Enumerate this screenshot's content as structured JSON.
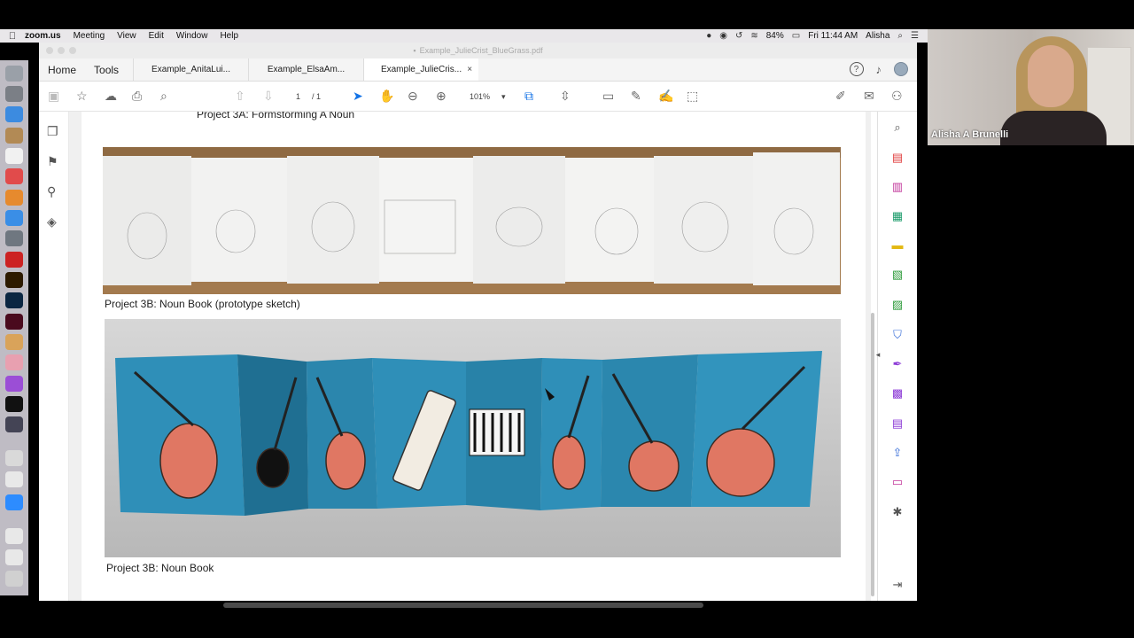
{
  "menubar": {
    "app": "zoom.us",
    "items": [
      "Meeting",
      "View",
      "Edit",
      "Window",
      "Help"
    ],
    "battery": "84%",
    "clock": "Fri 11:44 AM",
    "user": "Alisha"
  },
  "window": {
    "title": "Example_JulieCrist_BlueGrass.pdf",
    "home": "Home",
    "tools": "Tools",
    "tabs": [
      {
        "label": "Example_AnitaLui..."
      },
      {
        "label": "Example_ElsaAm..."
      },
      {
        "label": "Example_JulieCris..."
      }
    ],
    "tab_close": "×",
    "page_current": "1",
    "page_total": "/ 1",
    "zoom": "101%"
  },
  "document": {
    "caption_top": "Project 3A: Formstorming A Noun",
    "caption_sketch": "Project 3B: Noun Book (prototype sketch)",
    "caption_book": "Project 3B: Noun Book"
  },
  "webcam": {
    "name": "Alisha A Brunelli"
  },
  "colors": {
    "accent": "#1473e6",
    "book_blue": "#2f8fb8",
    "instrument_red": "#e07763"
  }
}
